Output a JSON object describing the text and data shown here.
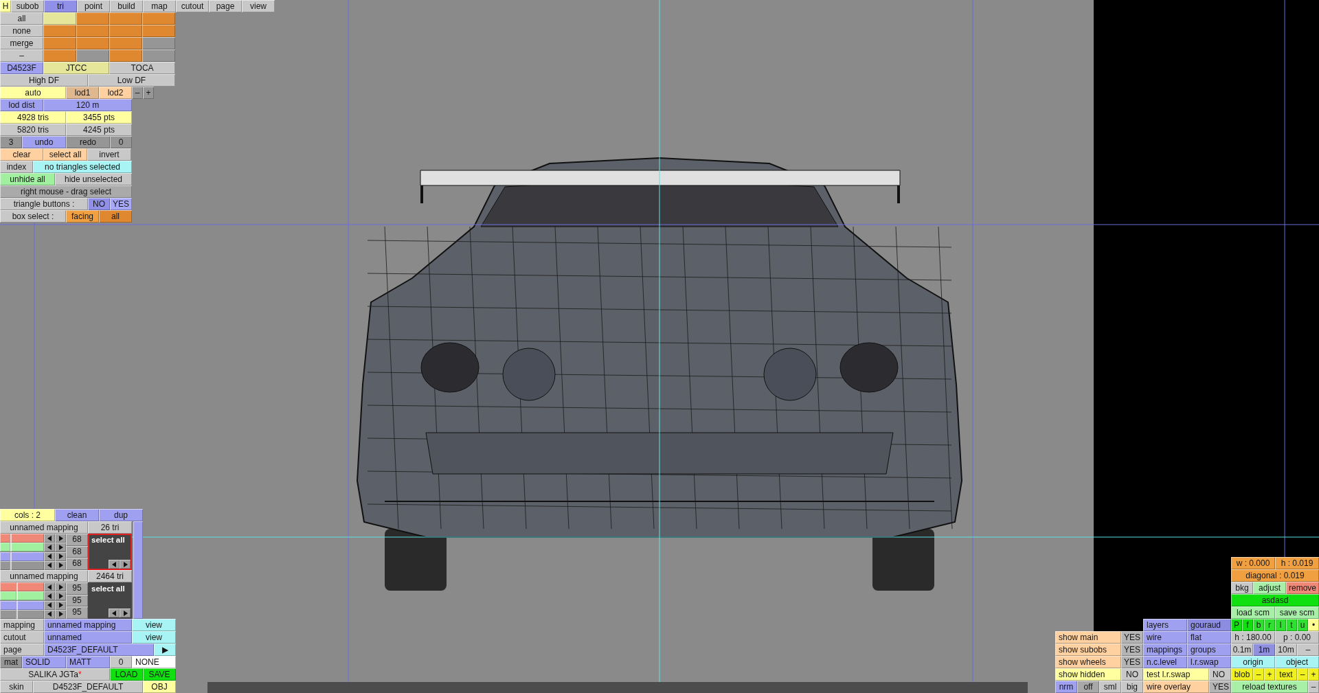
{
  "tabs": {
    "help": "H",
    "items": [
      {
        "label": "subob",
        "selected": false
      },
      {
        "label": "tri",
        "selected": true
      },
      {
        "label": "point",
        "selected": false
      },
      {
        "label": "build",
        "selected": false
      },
      {
        "label": "map",
        "selected": false
      },
      {
        "label": "cutout",
        "selected": false
      },
      {
        "label": "page",
        "selected": false
      },
      {
        "label": "view",
        "selected": false
      }
    ]
  },
  "selection_panel": {
    "swatch_rows": [
      {
        "label": "all",
        "swatches": [
          {
            "color": "#e6e69a"
          },
          {
            "color": "#e08830"
          },
          {
            "color": "#e08830"
          },
          {
            "color": "#e08830"
          }
        ]
      },
      {
        "label": "none",
        "swatches": [
          {
            "color": "#e08830"
          },
          {
            "color": "#e08830"
          },
          {
            "color": "#e08830"
          },
          {
            "color": "#e08830"
          }
        ]
      },
      {
        "label": "merge",
        "swatches": [
          {
            "color": "#e08830"
          },
          {
            "color": "#e08830"
          },
          {
            "color": "#e08830"
          },
          {
            "color": "#969696"
          }
        ]
      },
      {
        "label": "–",
        "swatches": [
          {
            "color": "#e08830"
          },
          {
            "color": "#969696"
          },
          {
            "color": "#e08830"
          },
          {
            "color": "#969696"
          }
        ]
      }
    ],
    "rows": [
      {
        "buttons": [
          {
            "text": "D4523F",
            "color": "#a0a0f0"
          },
          {
            "text": "JTCC",
            "color": "#e6e69a"
          },
          {
            "text": "TOCA",
            "color": "#c8c8c8"
          }
        ]
      },
      {
        "buttons": [
          {
            "text": "High DF",
            "color": "#c8c8c8"
          },
          {
            "text": "Low DF",
            "color": "#c8c8c8"
          }
        ]
      },
      {
        "buttons": [
          {
            "text": "auto",
            "color": "#ffffa0"
          },
          {
            "text": "lod1",
            "color": "#e0b890"
          },
          {
            "text": "lod2",
            "color": "#ffd0a0"
          },
          {
            "text": "–",
            "color": "#969696"
          },
          {
            "text": "+",
            "color": "#969696"
          }
        ]
      },
      {
        "buttons": [
          {
            "text": "lod dist",
            "color": "#a0a0f0"
          },
          {
            "text": "120 m",
            "color": "#a0a0f0"
          }
        ]
      },
      {
        "buttons": [
          {
            "text": "4928 tris",
            "color": "#ffffa0"
          },
          {
            "text": "3455 pts",
            "color": "#ffffa0"
          }
        ]
      },
      {
        "buttons": [
          {
            "text": "5820 tris",
            "color": "#c8c8c8"
          },
          {
            "text": "4245 pts",
            "color": "#c8c8c8"
          }
        ]
      },
      {
        "buttons": [
          {
            "text": "3",
            "color": "#969696"
          },
          {
            "text": "undo",
            "color": "#a0a0f0"
          },
          {
            "text": "redo",
            "color": "#969696"
          },
          {
            "text": "0",
            "color": "#969696"
          }
        ]
      },
      {
        "buttons": [
          {
            "text": "clear",
            "color": "#ffd0a0"
          },
          {
            "text": "select all",
            "color": "#ffd0a0"
          },
          {
            "text": "invert",
            "color": "#c8c8c8"
          }
        ]
      },
      {
        "buttons": [
          {
            "text": "index",
            "color": "#c8c8c8"
          },
          {
            "text": "no triangles selected",
            "color": "#a8f4f4"
          }
        ]
      },
      {
        "buttons": [
          {
            "text": "unhide all",
            "color": "#a0f0a0"
          },
          {
            "text": "hide unselected",
            "color": "#c8c8c8"
          }
        ]
      },
      {
        "buttons": [
          {
            "text": "right mouse - drag select",
            "color": "#aaaaaa"
          }
        ]
      },
      {
        "buttons": [
          {
            "text": "triangle buttons :",
            "color": "#c8c8c8"
          },
          {
            "text": "NO",
            "color": "#9090e8"
          },
          {
            "text": "YES",
            "color": "#a8a8f8"
          }
        ]
      },
      {
        "buttons": [
          {
            "text": "box select :",
            "color": "#c8c8c8"
          },
          {
            "text": "facing",
            "color": "#f0a040"
          },
          {
            "text": "all",
            "color": "#e08830"
          }
        ]
      }
    ]
  },
  "mapping_panel": {
    "header": [
      {
        "text": "cols : 2",
        "color": "#ffffa0"
      },
      {
        "text": "clean",
        "color": "#a0a0f0"
      },
      {
        "text": "dup",
        "color": "#a0a0f0"
      }
    ],
    "mappings": [
      {
        "name": "unnamed mapping",
        "count": "26 tri",
        "selected": true,
        "preview_label": "select all",
        "values": [
          "68",
          "68",
          "68"
        ],
        "channels": [
          {
            "color": "#f08878",
            "level": 0.24
          },
          {
            "color": "#a0f0a0",
            "level": 0.24
          },
          {
            "color": "#a0a0f0",
            "level": 0.24
          },
          {
            "color": "#969696",
            "level": 0.24
          }
        ]
      },
      {
        "name": "unnamed mapping",
        "count": "2464 tri",
        "selected": false,
        "preview_label": "select all",
        "values": [
          "95",
          "95",
          "95"
        ],
        "channels": [
          {
            "color": "#f08878",
            "level": 0.37
          },
          {
            "color": "#a0f0a0",
            "level": 0.37
          },
          {
            "color": "#a0a0f0",
            "level": 0.37
          },
          {
            "color": "#969696",
            "level": 0.37
          }
        ]
      }
    ],
    "rows": [
      {
        "buttons": [
          {
            "text": "mapping",
            "color": "#c8c8c8"
          },
          {
            "text": "unnamed mapping",
            "color": "#a0a0f0"
          },
          {
            "text": "view",
            "color": "#a8f4f4"
          }
        ]
      },
      {
        "buttons": [
          {
            "text": "cutout",
            "color": "#c8c8c8"
          },
          {
            "text": "unnamed",
            "color": "#a0a0f0"
          },
          {
            "text": "view",
            "color": "#a8f4f4"
          }
        ]
      },
      {
        "buttons": [
          {
            "text": "page",
            "color": "#c8c8c8"
          },
          {
            "text": "D4523F_DEFAULT",
            "color": "#a0a0f0"
          },
          {
            "text": "▶",
            "color": "#a8f4f4"
          }
        ]
      },
      {
        "buttons": [
          {
            "text": "mat",
            "color": "#969696"
          },
          {
            "text": "SOLID",
            "color": "#a0a0f0"
          },
          {
            "text": "MATT",
            "color": "#a0a0f0"
          },
          {
            "text": "0",
            "color": "#c8c8c8"
          },
          {
            "text": "NONE",
            "color": "#ffffff"
          }
        ]
      },
      {
        "buttons": [
          {
            "text": "SALIKA JGTa",
            "mark": "*",
            "color": "#c8c8c8"
          },
          {
            "text": "LOAD",
            "color": "#10e010"
          },
          {
            "text": "SAVE",
            "color": "#10e010"
          }
        ]
      },
      {
        "buttons": [
          {
            "text": "skin",
            "color": "#c8c8c8"
          },
          {
            "text": "D4523F_DEFAULT",
            "color": "#c8c8c8"
          },
          {
            "text": "OBJ",
            "color": "#ffffa0"
          }
        ]
      }
    ]
  },
  "view_panel": {
    "display_rows": [
      {
        "buttons": [
          {
            "text": "show main",
            "color": "#ffd0a0"
          },
          {
            "text": "YES",
            "color": "#b4b4b4"
          }
        ]
      },
      {
        "buttons": [
          {
            "text": "show subobs",
            "color": "#ffd0a0"
          },
          {
            "text": "YES",
            "color": "#b4b4b4"
          }
        ]
      },
      {
        "buttons": [
          {
            "text": "show wheels",
            "color": "#ffd0a0"
          },
          {
            "text": "YES",
            "color": "#b4b4b4"
          }
        ]
      },
      {
        "buttons": [
          {
            "text": "show hidden",
            "color": "#ffffa0"
          },
          {
            "text": "NO",
            "color": "#c8c8c8"
          }
        ]
      },
      {
        "buttons": [
          {
            "text": "nrm",
            "color": "#a0a0f0"
          },
          {
            "text": "off",
            "color": "#a8a8a8"
          },
          {
            "text": "sml",
            "color": "#c8c8c8"
          },
          {
            "text": "big",
            "color": "#c8c8c8"
          }
        ]
      }
    ],
    "layer_rows": [
      {
        "buttons": [
          {
            "text": "layers",
            "color": "#a0a0f0"
          },
          {
            "text": "gouraud",
            "color": "#8c8ce0"
          }
        ]
      },
      {
        "buttons": [
          {
            "text": "wire",
            "color": "#a0a0f0"
          },
          {
            "text": "flat",
            "color": "#a0a0f0"
          }
        ]
      },
      {
        "buttons": [
          {
            "text": "mappings",
            "color": "#a0a0f0"
          },
          {
            "text": "groups",
            "color": "#a0a0f0"
          }
        ]
      },
      {
        "buttons": [
          {
            "text": "n.c.level",
            "color": "#a0a0f0"
          },
          {
            "text": "l.r.swap",
            "color": "#a0a0f0"
          }
        ]
      },
      {
        "buttons": [
          {
            "text": "test l.r.swap",
            "color": "#ffffa0"
          },
          {
            "text": "NO",
            "color": "#c8c8c8"
          }
        ]
      },
      {
        "buttons": [
          {
            "text": "wire overlay",
            "color": "#ffd0a0"
          },
          {
            "text": "YES",
            "color": "#b4b4b4"
          }
        ]
      }
    ],
    "tool_rows": [
      {
        "buttons": [
          {
            "text": "w : 0.000",
            "color": "#f0a040"
          },
          {
            "text": "h : 0.019",
            "color": "#f0a040"
          }
        ]
      },
      {
        "buttons": [
          {
            "text": "diagonal : 0.019",
            "color": "#f0a040"
          }
        ]
      },
      {
        "buttons": [
          {
            "text": "bkg",
            "color": "#c8c8c8"
          },
          {
            "text": "adjust",
            "color": "#a8f0a8"
          },
          {
            "text": "remove",
            "color": "#f08878"
          }
        ]
      },
      {
        "buttons": [
          {
            "text": "asdasd",
            "color": "#10e010"
          }
        ]
      },
      {
        "buttons": [
          {
            "text": "load scm",
            "color": "#a8f0a8"
          },
          {
            "text": "save scm",
            "color": "#a8f0a8"
          }
        ]
      },
      {
        "buttons": [
          {
            "text": "P",
            "color": "#10e010"
          },
          {
            "text": "f",
            "color": "#10e010"
          },
          {
            "text": "b",
            "color": "#30e030"
          },
          {
            "text": "r",
            "color": "#30e030"
          },
          {
            "text": "l",
            "color": "#30e030"
          },
          {
            "text": "t",
            "color": "#30e030"
          },
          {
            "text": "u",
            "color": "#30e030"
          },
          {
            "text": "•",
            "color": "#ffff90"
          }
        ]
      },
      {
        "buttons": [
          {
            "text": "h : 180.00",
            "color": "#c8c8c8"
          },
          {
            "text": "p : 0.00",
            "color": "#c8c8c8"
          }
        ]
      },
      {
        "buttons": [
          {
            "text": "0.1m",
            "color": "#c8c8c8"
          },
          {
            "text": "1m",
            "color": "#9090e0"
          },
          {
            "text": "10m",
            "color": "#c8c8c8"
          },
          {
            "text": "–",
            "color": "#c8c8c8"
          }
        ]
      },
      {
        "buttons": [
          {
            "text": "origin",
            "color": "#a8f4f4"
          },
          {
            "text": "object",
            "color": "#a8f4f4"
          }
        ]
      },
      {
        "buttons": [
          {
            "text": "blob",
            "color": "#f0f020"
          },
          {
            "text": "–",
            "color": "#f0f020"
          },
          {
            "text": "+",
            "color": "#f0f020"
          },
          {
            "text": "text",
            "color": "#f0f020"
          },
          {
            "text": "–",
            "color": "#f0f020"
          },
          {
            "text": "+",
            "color": "#f0f020"
          }
        ]
      },
      {
        "buttons": [
          {
            "text": "reload textures",
            "color": "#a8f0a8"
          },
          {
            "text": "–",
            "color": "#c8c8c8"
          }
        ]
      }
    ]
  }
}
